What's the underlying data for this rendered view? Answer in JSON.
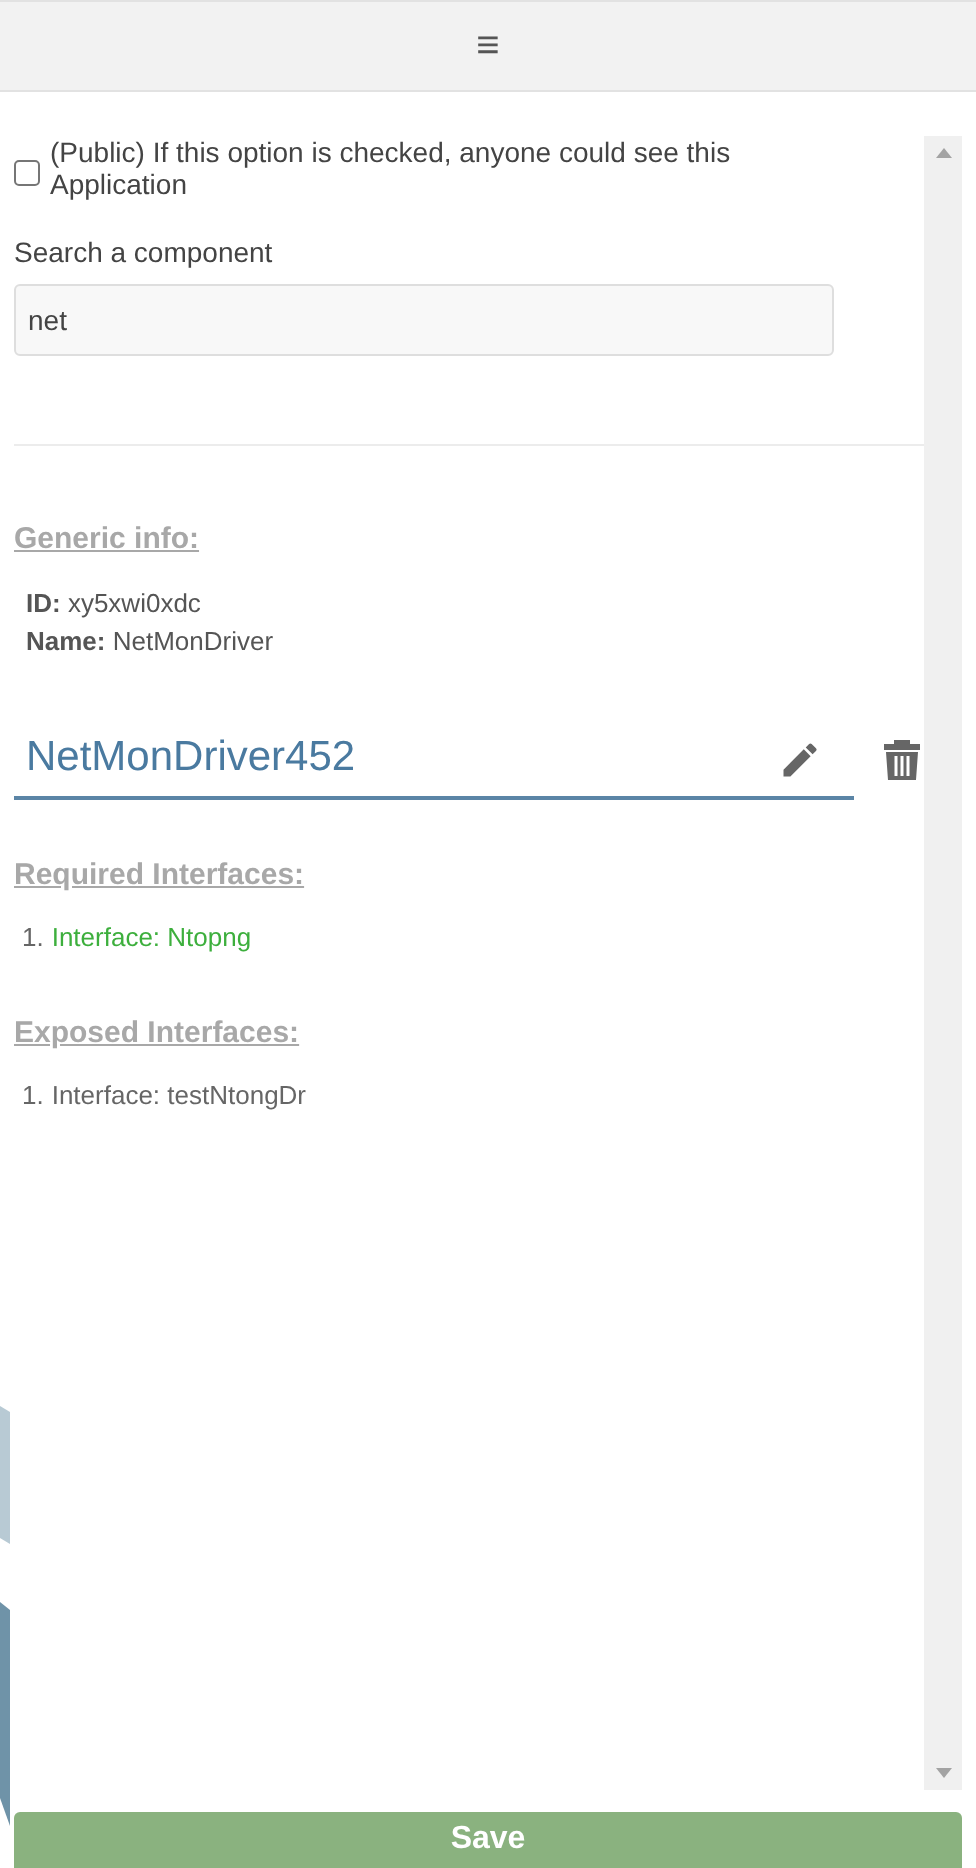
{
  "header": {
    "menu_glyph": "≡"
  },
  "public_option": {
    "label": "(Public) If this option is checked, anyone could see this Application",
    "checked": false
  },
  "search": {
    "label": "Search a component",
    "value": "net"
  },
  "generic_info": {
    "heading": "Generic info:",
    "lines": [
      "**ID:** xy5xwi0xdc",
      "**Name:** NetMonDriver"
    ]
  },
  "name_field": {
    "value": "NetMonDriver452"
  },
  "required_interfaces": {
    "heading": "Required Interfaces:",
    "items": [
      {
        "number": "1.",
        "text": "Interface: Ntopng",
        "color": "#3daf3d"
      }
    ]
  },
  "exposed_interfaces": {
    "heading": "Exposed Interfaces:",
    "items": [
      {
        "number": "1.",
        "text": "Interface: testNtongDr",
        "color": "#666666"
      }
    ]
  },
  "save_button": {
    "label": "Save"
  }
}
